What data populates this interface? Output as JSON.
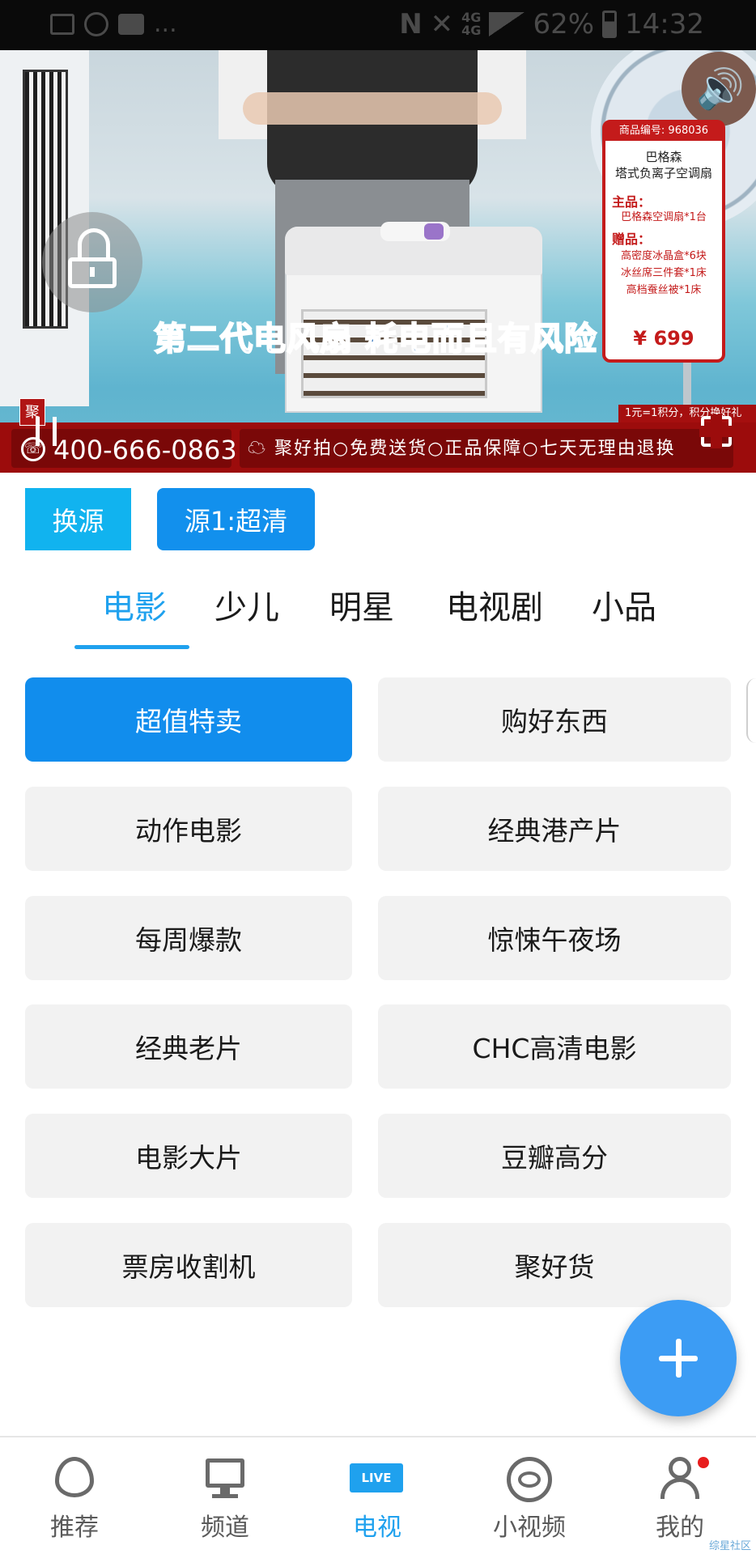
{
  "status_bar": {
    "left_icons": [
      "image-icon",
      "sync-icon",
      "message-icon"
    ],
    "ellipsis": "...",
    "nfc": "N",
    "net_type_top": "4G",
    "net_type_bottom": "4G",
    "battery": "62%",
    "time": "14:32"
  },
  "player": {
    "caption": "第二代电风扇 耗电而且有风险",
    "lock_icon": "unlock-icon",
    "volume_icon": "volume-icon",
    "corner_tag": "聚",
    "hotline": "400-666-0863",
    "slogan": "聚好拍○免费送货○正品保障○七天无理由退换",
    "footnote": "1元=1积分，积分换好礼",
    "product": {
      "code": "商品编号: 968036",
      "brand": "巴格森",
      "name": "塔式负离子空调扇",
      "main_label": "主品：",
      "main_item": "巴格森空调扇*1台",
      "gift_label": "赠品：",
      "gifts": [
        "高密度冰晶盒*6块",
        "冰丝席三件套*1床",
        "高档蚕丝被*1床"
      ],
      "price": "¥ 699"
    }
  },
  "source": {
    "switch_label": "换源",
    "current_label": "源1:超清"
  },
  "tabs": [
    {
      "label": "电影",
      "active": true
    },
    {
      "label": "少儿",
      "active": false
    },
    {
      "label": "明星",
      "active": false
    },
    {
      "label": "电视剧",
      "active": false
    },
    {
      "label": "小品",
      "active": false
    }
  ],
  "channels": [
    {
      "label": "超值特卖",
      "selected": true
    },
    {
      "label": "购好东西",
      "selected": false
    },
    {
      "label": "动作电影",
      "selected": false
    },
    {
      "label": "经典港产片",
      "selected": false
    },
    {
      "label": "每周爆款",
      "selected": false
    },
    {
      "label": "惊悚午夜场",
      "selected": false
    },
    {
      "label": "经典老片",
      "selected": false
    },
    {
      "label": "CHC高清电影",
      "selected": false
    },
    {
      "label": "电影大片",
      "selected": false
    },
    {
      "label": "豆瓣高分",
      "selected": false
    },
    {
      "label": "票房收割机",
      "selected": false
    },
    {
      "label": "聚好货",
      "selected": false
    }
  ],
  "fab": {
    "icon": "plus-icon"
  },
  "bottom_nav": [
    {
      "label": "推荐",
      "icon": "flame-icon",
      "active": false
    },
    {
      "label": "频道",
      "icon": "monitor-icon",
      "active": false
    },
    {
      "label": "电视",
      "icon": "live-icon",
      "icon_text": "LIVE",
      "active": true
    },
    {
      "label": "小视频",
      "icon": "eye-icon",
      "active": false
    },
    {
      "label": "我的",
      "icon": "user-icon",
      "active": false,
      "badge": true
    }
  ],
  "watermark": "综星社区",
  "colors": {
    "accent": "#1fa1ee",
    "selected_channel": "#118ded",
    "switch_button": "#11b3ef",
    "ticker_red": "#9c0c0c",
    "fab": "#3c9cf4"
  }
}
